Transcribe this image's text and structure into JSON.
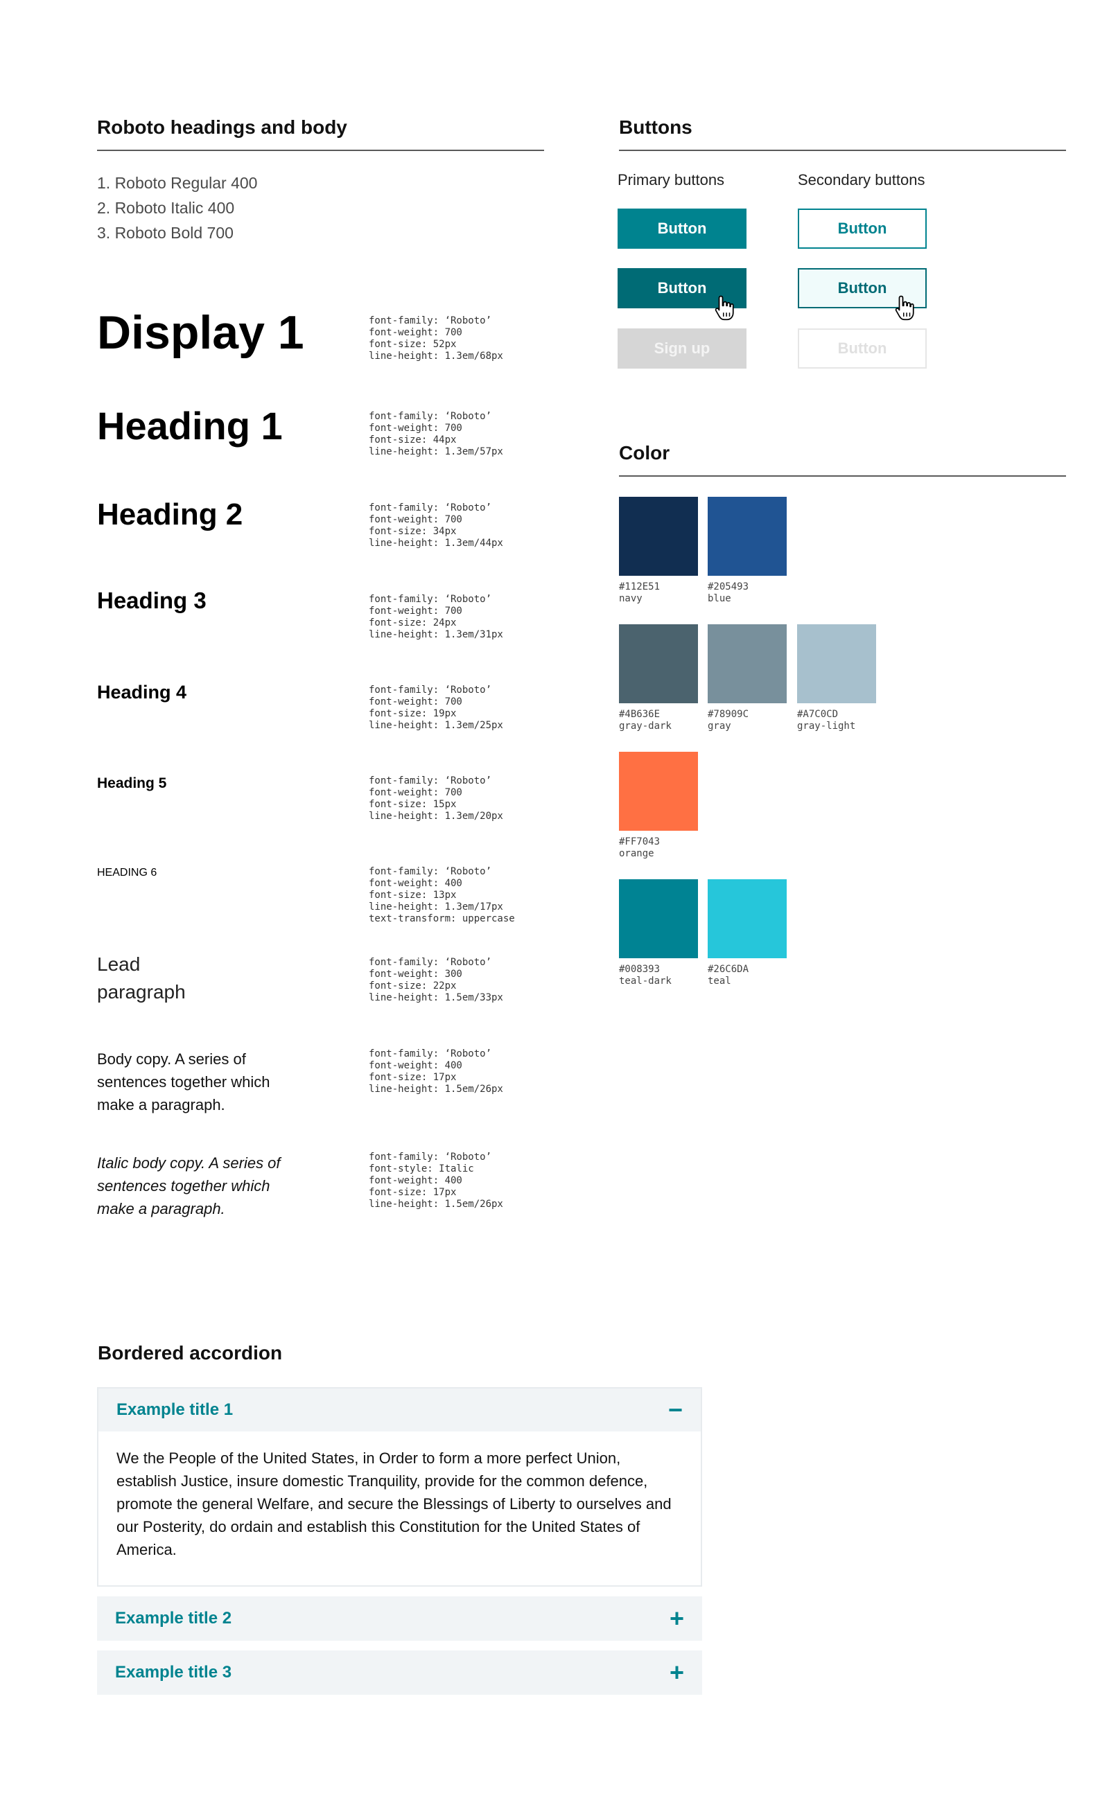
{
  "typography": {
    "title": "Roboto headings and body",
    "fonts": [
      "1. Roboto Regular 400",
      "2. Roboto Italic 400",
      "3. Roboto Bold 700"
    ],
    "samples": [
      {
        "label": "Display 1",
        "spec": "font-family: ‘Roboto’\nfont-weight: 700\nfont-size: 52px\nline-height: 1.3em/68px"
      },
      {
        "label": "Heading 1",
        "spec": "font-family: ‘Roboto’\nfont-weight: 700\nfont-size: 44px\nline-height: 1.3em/57px"
      },
      {
        "label": "Heading 2",
        "spec": "font-family: ‘Roboto’\nfont-weight: 700\nfont-size: 34px\nline-height: 1.3em/44px"
      },
      {
        "label": "Heading 3",
        "spec": "font-family: ‘Roboto’\nfont-weight: 700\nfont-size: 24px\nline-height: 1.3em/31px"
      },
      {
        "label": "Heading 4",
        "spec": "font-family: ‘Roboto’\nfont-weight: 700\nfont-size: 19px\nline-height: 1.3em/25px"
      },
      {
        "label": "Heading 5",
        "spec": "font-family: ‘Roboto’\nfont-weight: 700\nfont-size: 15px\nline-height: 1.3em/20px"
      },
      {
        "label": "HEADING 6",
        "spec": "font-family: ‘Roboto’\nfont-weight: 400\nfont-size: 13px\nline-height: 1.3em/17px\ntext-transform: uppercase"
      },
      {
        "label": "Lead paragraph",
        "spec": "font-family: ‘Roboto’\nfont-weight: 300\nfont-size: 22px\nline-height: 1.5em/33px"
      },
      {
        "label": "Body copy. A series of sentences together which make a paragraph.",
        "spec": "font-family: ‘Roboto’\nfont-weight: 400\nfont-size: 17px\nline-height: 1.5em/26px"
      },
      {
        "label": "Italic body copy. A series of sentences together which make a paragraph.",
        "spec": "font-family: ‘Roboto’\nfont-style: Italic\nfont-weight: 400\nfont-size: 17px\nline-height: 1.5em/26px"
      }
    ]
  },
  "buttons": {
    "title": "Buttons",
    "primary_label": "Primary buttons",
    "secondary_label": "Secondary buttons",
    "primary": [
      "Button",
      "Button",
      "Sign up"
    ],
    "secondary": [
      "Button",
      "Button",
      "Button"
    ]
  },
  "color": {
    "title": "Color",
    "swatches": [
      {
        "hex": "#112E51",
        "name": "navy",
        "color": "#112E51"
      },
      {
        "hex": "#205493",
        "name": "blue",
        "color": "#205493"
      },
      {
        "hex": "#4B636E",
        "name": "gray-dark",
        "color": "#4B636E"
      },
      {
        "hex": "#78909C",
        "name": "gray",
        "color": "#78909C"
      },
      {
        "hex": "#A7C0CD",
        "name": "gray-light",
        "color": "#A7C0CD"
      },
      {
        "hex": "#FF7043",
        "name": "orange",
        "color": "#FF7043"
      },
      {
        "hex": "#008393",
        "name": "teal-dark",
        "color": "#008393"
      },
      {
        "hex": "#26C6DA",
        "name": "teal",
        "color": "#26C6DA"
      }
    ]
  },
  "accordion": {
    "title": "Bordered accordion",
    "items": [
      {
        "title": "Example title 1",
        "icon": "−",
        "body": "We the People of the United States, in Order to form a more perfect Union, establish Justice, insure domestic Tranquility, provide for the common defence, promote the general Welfare, and secure the Blessings of Liberty to ourselves and our Posterity, do ordain and establish this Constitution for the United States of America."
      },
      {
        "title": "Example title 2",
        "icon": "+"
      },
      {
        "title": "Example title 3",
        "icon": "+"
      }
    ]
  }
}
